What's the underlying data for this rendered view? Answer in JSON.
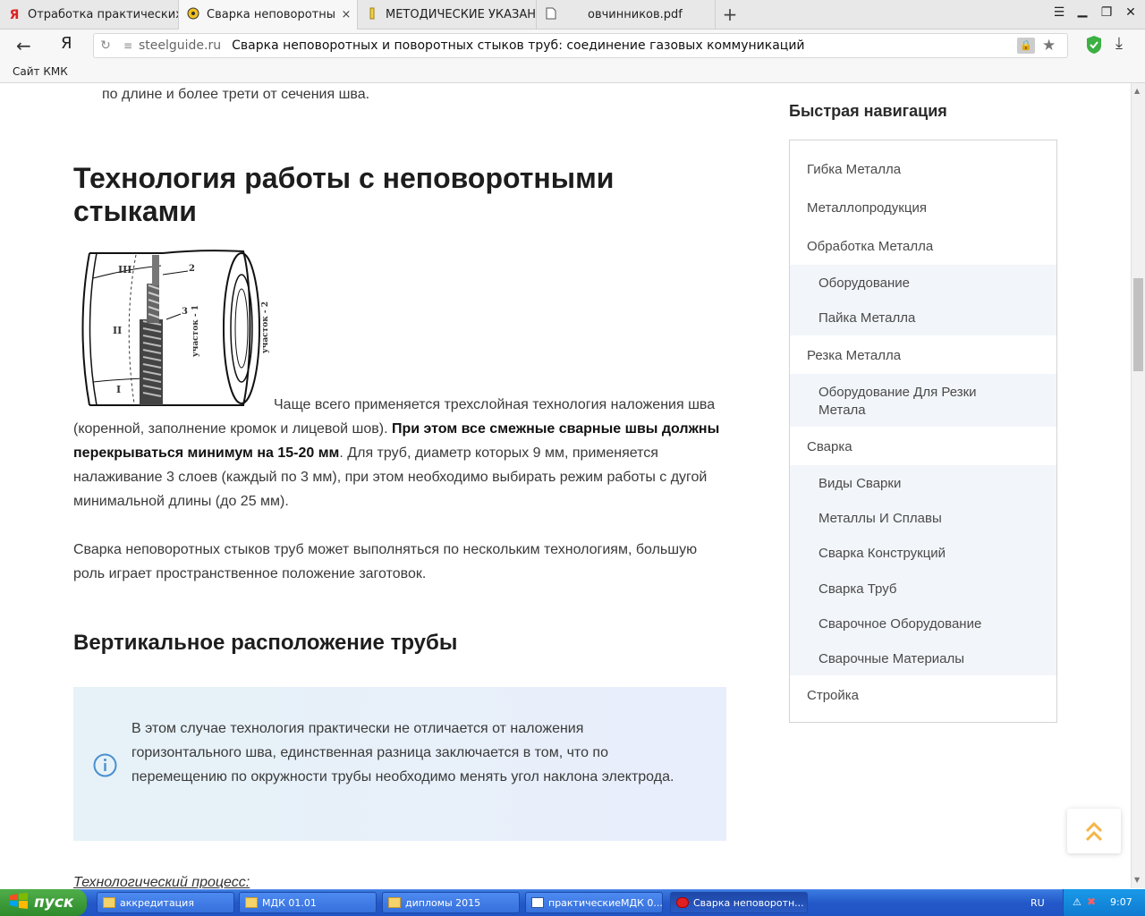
{
  "tabs": [
    {
      "label": "Отработка практических на",
      "icon": "yandex-icon"
    },
    {
      "label": "Сварка неповоротных и по",
      "icon": "site-favicon"
    },
    {
      "label": "МЕТОДИЧЕСКИЕ УКАЗАНИЯ",
      "icon": "doc-icon"
    },
    {
      "label": "овчинников.pdf",
      "icon": "file-icon"
    }
  ],
  "tab_close": "×",
  "new_tab": "+",
  "address": {
    "domain": "steelguide.ru",
    "title": "Сварка неповоротных и поворотных стыков труб: соединение газовых коммуникаций"
  },
  "yandex_logo": "Я",
  "bookmarks": [
    "Сайт КМК"
  ],
  "article": {
    "top_line": "по длине и более трети от сечения шва.",
    "heading1": "Технология работы с неповоротными стыками",
    "para1_a": "Чаще всего применяется трехслойная технология наложения шва (коренной, заполнение кромок и лицевой шов). ",
    "para1_bold": "При этом все смежные сварные швы должны перекрываться минимум на 15-20 мм",
    "para1_b": ". Для труб, диаметр которых 9 мм, применяется налаживание 3 слоев (каждый по 3 мм), при этом необходимо выбирать режим работы с дугой минимальной длины (до 25 мм).",
    "para2": "Сварка неповоротных стыков труб может выполняться по нескольким технологиям, большую роль играет пространственное положение заготовок.",
    "heading2": "Вертикальное расположение трубы",
    "info": "В этом случае технология практически не отличается от наложения горизонтального шва, единственная разница заключается в том, что по перемещению по окружности трубы необходимо менять угол наклона электрода.",
    "bottom_italic": "Технологический процесс:",
    "figure_labels": {
      "r1": "I",
      "r2": "II",
      "r3": "III",
      "n2": "2",
      "n3": "3",
      "u1": "участок - 1",
      "u2": "участок - 2"
    }
  },
  "sidebar": {
    "title": "Быстрая навигация",
    "items": [
      {
        "label": "Гибка Металла",
        "sub": false
      },
      {
        "label": "Металлопродукция",
        "sub": false
      },
      {
        "label": "Обработка Металла",
        "sub": false
      },
      {
        "label": "Оборудование",
        "sub": true
      },
      {
        "label": "Пайка Металла",
        "sub": true
      },
      {
        "label": "Резка Металла",
        "sub": false
      },
      {
        "label": "Оборудование Для Резки Метала",
        "sub": true
      },
      {
        "label": "Сварка",
        "sub": false
      },
      {
        "label": "Виды Сварки",
        "sub": true
      },
      {
        "label": "Металлы И Сплавы",
        "sub": true
      },
      {
        "label": "Сварка Конструкций",
        "sub": true
      },
      {
        "label": "Сварка Труб",
        "sub": true
      },
      {
        "label": "Сварочное Оборудование",
        "sub": true
      },
      {
        "label": "Сварочные Материалы",
        "sub": true
      },
      {
        "label": "Стройка",
        "sub": false
      }
    ]
  },
  "taskbar": {
    "start": "пуск",
    "tasks": [
      "аккредитация",
      "МДК 01.01",
      "дипломы 2015",
      "практическиеМДК 0...",
      "Сварка неповоротн..."
    ],
    "lang": "RU",
    "clock": "9:07"
  },
  "colors": {
    "accent": "#4a8fd0",
    "info_bg": "#e9f1fb",
    "taskbar": "#2458c8",
    "start": "#3a9a36",
    "scroll_up": "#f5b547"
  }
}
